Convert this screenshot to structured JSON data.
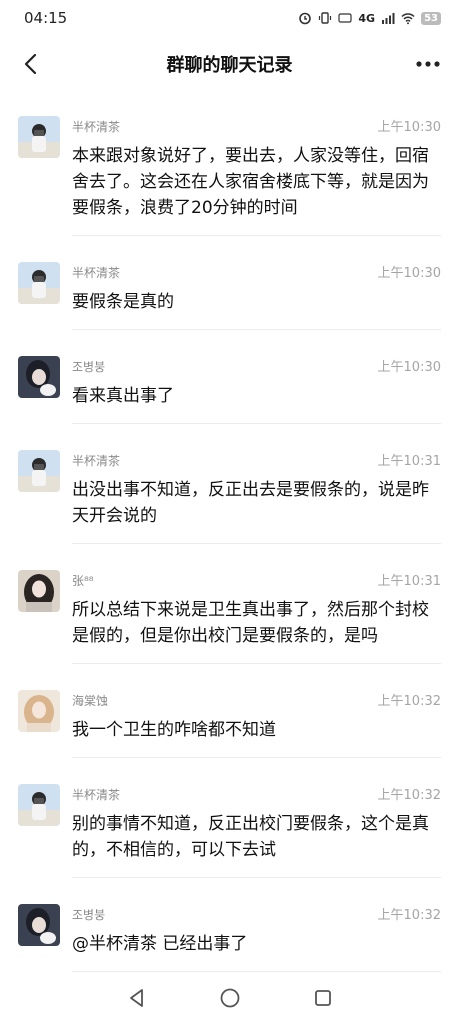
{
  "status": {
    "time": "04:15",
    "network": "4G",
    "battery": "53"
  },
  "header": {
    "title": "群聊的聊天记录"
  },
  "messages": [
    {
      "sender": "半杯清茶",
      "time": "上午10:30",
      "text": "本来跟对象说好了，要出去，人家没等住，回宿舍去了。这会还在人家宿舍楼底下等，就是因为要假条，浪费了20分钟的时间",
      "avatar": "boy-camera"
    },
    {
      "sender": "半杯清茶",
      "time": "上午10:30",
      "text": "要假条是真的",
      "avatar": "boy-camera"
    },
    {
      "sender": "조병붕",
      "time": "上午10:30",
      "text": "看来真出事了",
      "avatar": "girl-dark"
    },
    {
      "sender": "半杯清茶",
      "time": "上午10:31",
      "text": "出没出事不知道，反正出去是要假条的，说是昨天开会说的",
      "avatar": "boy-camera"
    },
    {
      "sender": "张⁸⁸",
      "time": "上午10:31",
      "text": "所以总结下来说是卫生真出事了，然后那个封校是假的，但是你出校门是要假条的，是吗",
      "avatar": "girl-long"
    },
    {
      "sender": "海棠蚀",
      "time": "上午10:32",
      "text": "我一个卫生的咋啥都不知道",
      "avatar": "girl-blonde"
    },
    {
      "sender": "半杯清茶",
      "time": "上午10:32",
      "text": "别的事情不知道，反正出校门要假条，这个是真的，不相信的，可以下去试",
      "avatar": "boy-camera"
    },
    {
      "sender": "조병붕",
      "time": "上午10:32",
      "text": "@半杯清茶 已经出事了",
      "avatar": "girl-dark"
    }
  ]
}
